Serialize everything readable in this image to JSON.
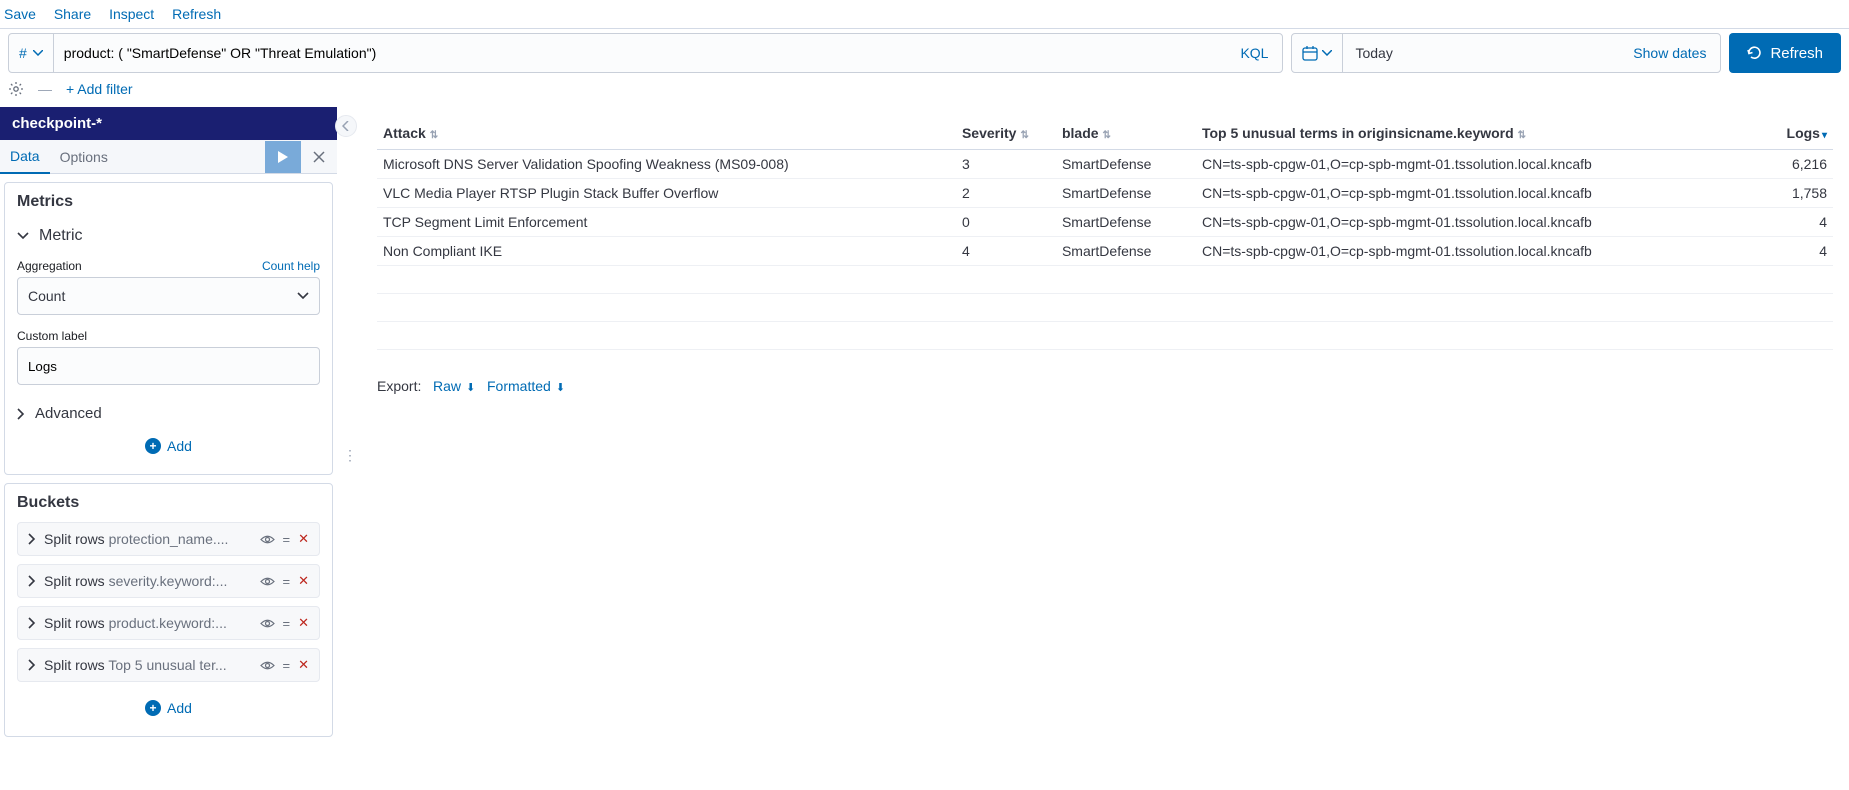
{
  "topnav": {
    "save": "Save",
    "share": "Share",
    "inspect": "Inspect",
    "refresh": "Refresh"
  },
  "query": {
    "prefix": "#",
    "value": "product: ( \"SmartDefense\" OR \"Threat Emulation\")",
    "lang": "KQL",
    "dateValue": "Today",
    "showDates": "Show dates",
    "refreshBtn": "Refresh",
    "addFilter": "+ Add filter"
  },
  "indexPattern": "checkpoint-*",
  "tabs": {
    "data": "Data",
    "options": "Options"
  },
  "metrics": {
    "title": "Metrics",
    "metricLabel": "Metric",
    "aggregationLabel": "Aggregation",
    "countHelp": "Count help",
    "aggregationValue": "Count",
    "customLabelLabel": "Custom label",
    "customLabelValue": "Logs",
    "advanced": "Advanced",
    "add": "Add"
  },
  "buckets": {
    "title": "Buckets",
    "splitRows": "Split rows",
    "items": [
      {
        "sub": "protection_name...."
      },
      {
        "sub": "severity.keyword:..."
      },
      {
        "sub": "product.keyword:..."
      },
      {
        "sub": "Top 5 unusual ter..."
      }
    ],
    "add": "Add"
  },
  "table": {
    "headers": [
      "Attack",
      "Severity",
      "blade",
      "Top 5 unusual terms in originsicname.keyword",
      "Logs"
    ],
    "rows": [
      {
        "attack": "Microsoft DNS Server Validation Spoofing Weakness (MS09-008)",
        "severity": "3",
        "blade": "SmartDefense",
        "origin": "CN=ts-spb-cpgw-01,O=cp-spb-mgmt-01.tssolution.local.kncafb",
        "logs": "6,216"
      },
      {
        "attack": "VLC Media Player RTSP Plugin Stack Buffer Overflow",
        "severity": "2",
        "blade": "SmartDefense",
        "origin": "CN=ts-spb-cpgw-01,O=cp-spb-mgmt-01.tssolution.local.kncafb",
        "logs": "1,758"
      },
      {
        "attack": "TCP Segment Limit Enforcement",
        "severity": "0",
        "blade": "SmartDefense",
        "origin": "CN=ts-spb-cpgw-01,O=cp-spb-mgmt-01.tssolution.local.kncafb",
        "logs": "4"
      },
      {
        "attack": "Non Compliant IKE",
        "severity": "4",
        "blade": "SmartDefense",
        "origin": "CN=ts-spb-cpgw-01,O=cp-spb-mgmt-01.tssolution.local.kncafb",
        "logs": "4"
      }
    ]
  },
  "export": {
    "label": "Export:",
    "raw": "Raw",
    "formatted": "Formatted"
  }
}
